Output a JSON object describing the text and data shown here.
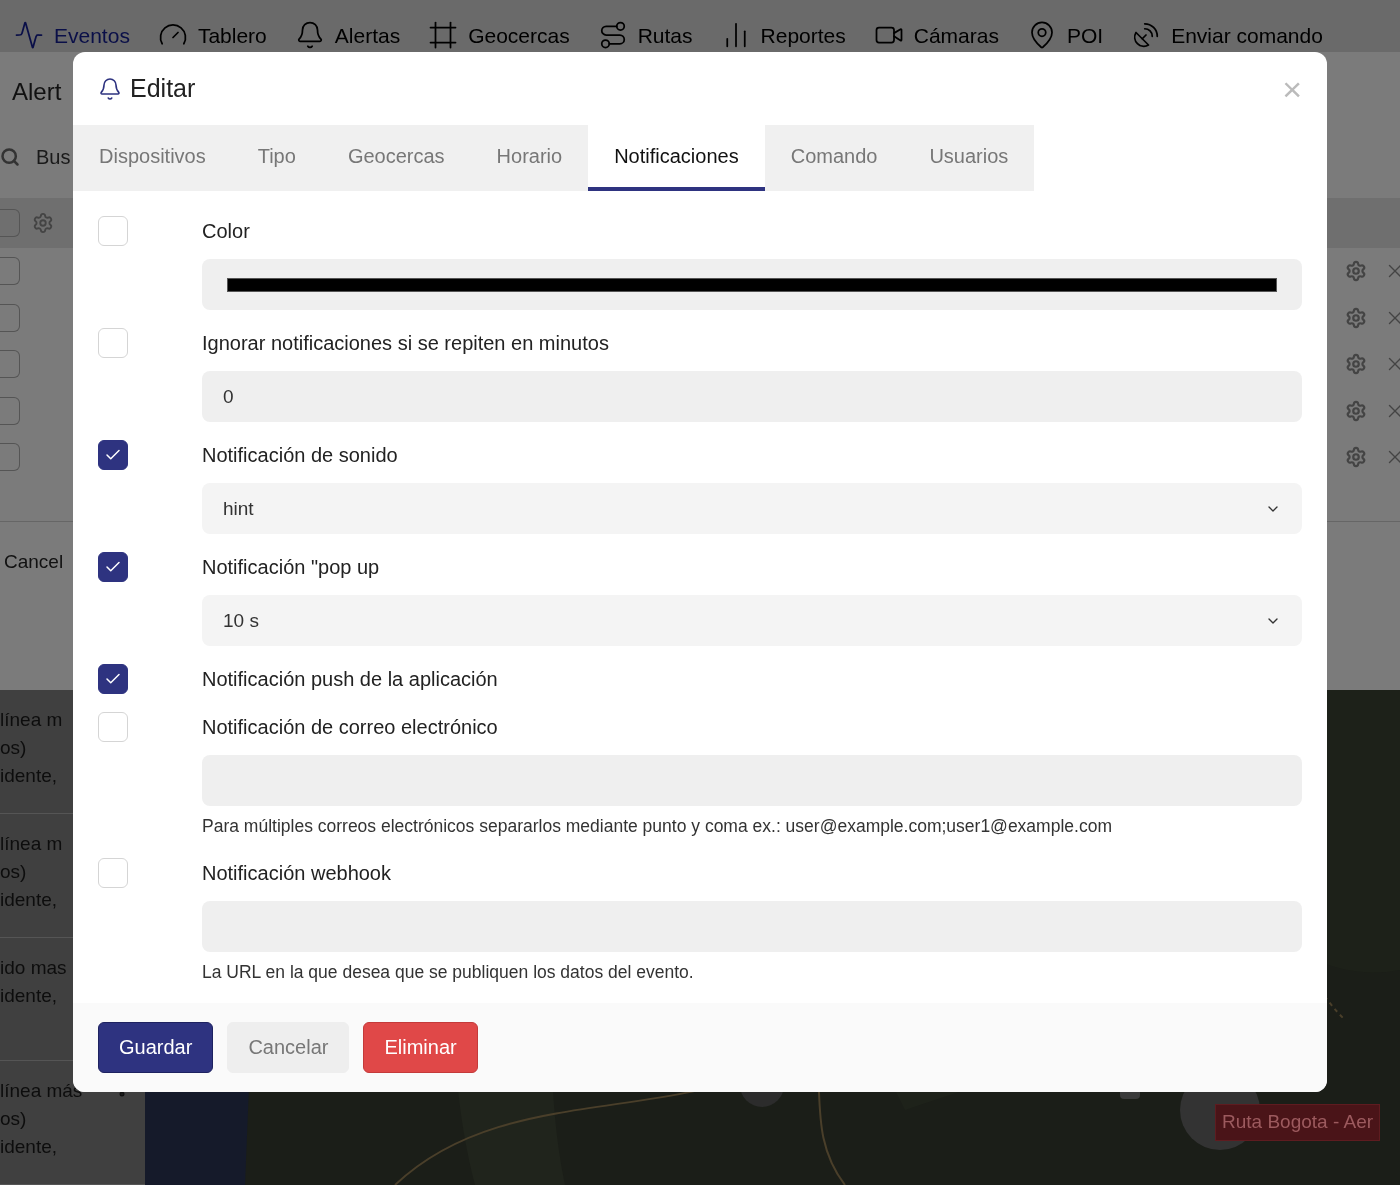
{
  "nav": [
    {
      "label": "Eventos",
      "selected": true
    },
    {
      "label": "Tablero",
      "selected": false
    },
    {
      "label": "Alertas",
      "selected": false
    },
    {
      "label": "Geocercas",
      "selected": false
    },
    {
      "label": "Rutas",
      "selected": false
    },
    {
      "label": "Reportes",
      "selected": false
    },
    {
      "label": "Cámaras",
      "selected": false
    },
    {
      "label": "POI",
      "selected": false
    },
    {
      "label": "Enviar comando",
      "selected": false
    }
  ],
  "alerts_panel": {
    "title": "Alert",
    "search_placeholder": "Bus",
    "header_checked": false,
    "rows": [
      {
        "checked": false
      },
      {
        "checked": false
      },
      {
        "checked": false
      },
      {
        "checked": false
      },
      {
        "checked": false
      }
    ],
    "cancel_label": "Cancel"
  },
  "event_list": [
    {
      "lines": [
        "línea m",
        "os)",
        "idente,"
      ]
    },
    {
      "lines": [
        "línea m",
        "os)",
        "idente,"
      ]
    },
    {
      "lines": [
        "ido mas",
        "idente,"
      ]
    },
    {
      "lines": [
        "línea más",
        "os)",
        "idente,"
      ]
    }
  ],
  "map": {
    "route_label": "Ruta Bogota - Aer"
  },
  "dialog": {
    "title": "Editar",
    "close": "×",
    "tabs": [
      {
        "label": "Dispositivos",
        "selected": false
      },
      {
        "label": "Tipo",
        "selected": false
      },
      {
        "label": "Geocercas",
        "selected": false
      },
      {
        "label": "Horario",
        "selected": false
      },
      {
        "label": "Notificaciones",
        "selected": true
      },
      {
        "label": "Comando",
        "selected": false
      },
      {
        "label": "Usuarios",
        "selected": false
      }
    ],
    "settings": [
      {
        "kind": "color",
        "checked": false,
        "label": "Color",
        "color": "#000000"
      },
      {
        "kind": "input",
        "checked": false,
        "label": "Ignorar notificaciones si se repiten en minutos",
        "value": "0"
      },
      {
        "kind": "select",
        "checked": true,
        "label": "Notificación de sonido",
        "value": "hint"
      },
      {
        "kind": "select",
        "checked": true,
        "label": "Notificación \"pop up",
        "value": "10 s"
      },
      {
        "kind": "plain",
        "checked": true,
        "label": "Notificación push de la aplicación"
      },
      {
        "kind": "input",
        "checked": false,
        "label": "Notificación de correo electrónico",
        "help": "Para múltiples correos electrónicos separarlos mediante punto y coma ex.: user@example.com;user1@example.com"
      },
      {
        "kind": "input",
        "checked": false,
        "label": "Notificación webhook",
        "help": "La URL en la que desea que se publiquen los datos del evento."
      }
    ],
    "buttons": [
      {
        "kind": "primary",
        "label": "Guardar"
      },
      {
        "kind": "secondary",
        "label": "Cancelar"
      },
      {
        "kind": "danger",
        "label": "Eliminar"
      }
    ]
  }
}
